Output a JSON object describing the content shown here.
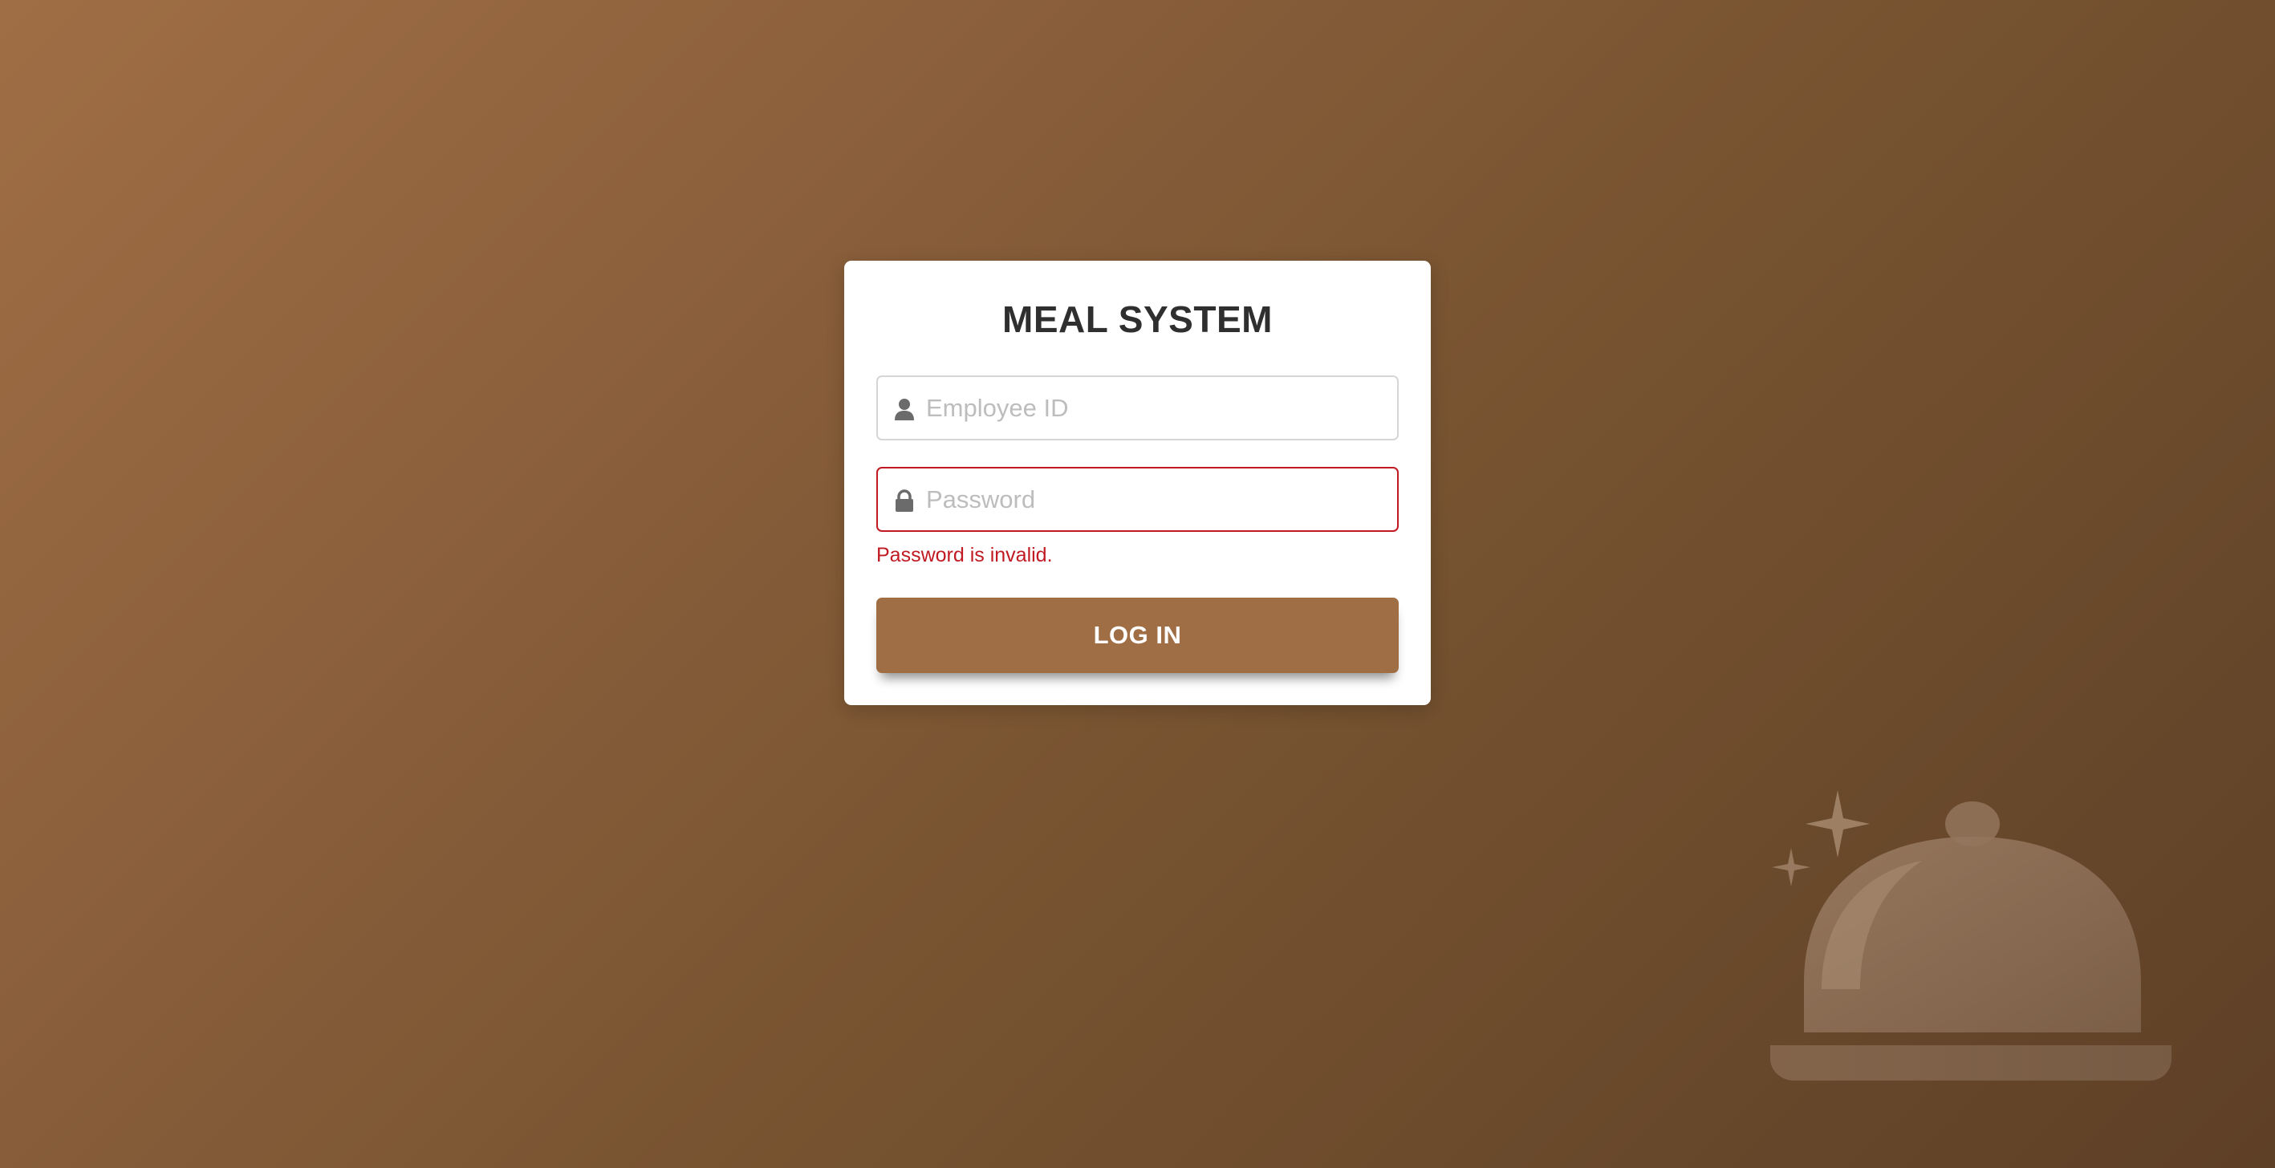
{
  "app": {
    "title": "MEAL SYSTEM"
  },
  "login": {
    "employee_id": {
      "placeholder": "Employee ID",
      "value": "",
      "icon": "user-icon"
    },
    "password": {
      "placeholder": "Password",
      "value": "",
      "icon": "lock-icon",
      "error": "Password is invalid."
    },
    "submit_label": "LOG IN"
  },
  "colors": {
    "accent": "#a06e45",
    "error": "#c11a22",
    "background_start": "#a06e45",
    "background_end": "#5e4027"
  },
  "decoration": {
    "icon": "serving-cloche-icon"
  }
}
